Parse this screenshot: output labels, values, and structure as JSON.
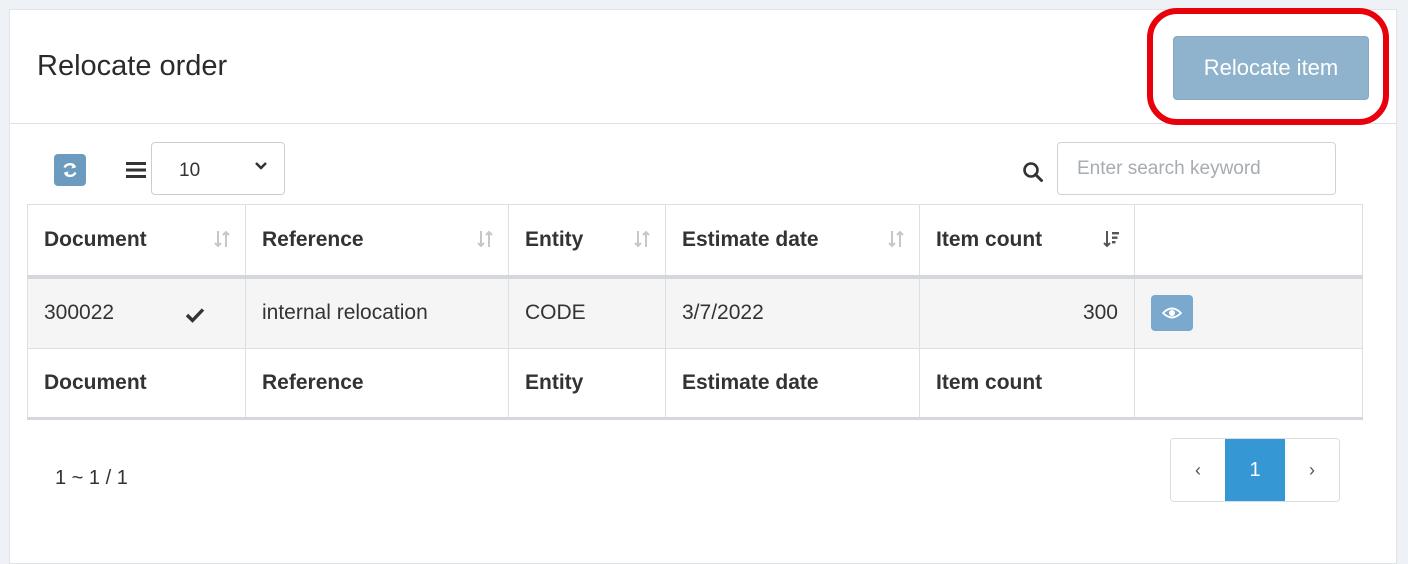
{
  "header": {
    "title": "Relocate order",
    "action_label": "Relocate item"
  },
  "toolbar": {
    "page_size": "10",
    "search_placeholder": "Enter search keyword"
  },
  "table": {
    "columns": [
      "Document",
      "Reference",
      "Entity",
      "Estimate date",
      "Item count"
    ],
    "rows": [
      {
        "document": "300022",
        "reference": "internal relocation",
        "entity": "CODE",
        "estimate_date": "3/7/2022",
        "item_count": "300"
      }
    ]
  },
  "footer": {
    "summary": "1 ~ 1 / 1",
    "pages": {
      "prev": "‹",
      "current": "1",
      "next": "›"
    }
  },
  "colors": {
    "accent": "#3597d3",
    "button": "#8fb3cc",
    "highlight": "#e8000b"
  },
  "icons": [
    "refresh-icon",
    "list-icon",
    "chevron-down-icon",
    "search-icon",
    "sort-icon",
    "check-icon",
    "eye-icon"
  ]
}
